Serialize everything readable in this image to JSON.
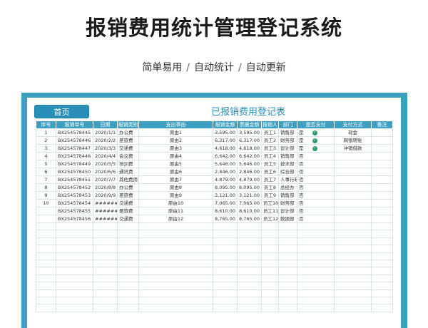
{
  "promo": {
    "title": "报销费用统计管理登记系统",
    "features": [
      "简单易用",
      "自动统计",
      "自动更新"
    ],
    "separator": "/"
  },
  "sheet": {
    "home_button": "首页",
    "title": "已报销费用登记表"
  },
  "table": {
    "headers": [
      "序号",
      "报销单号",
      "日期",
      "报销类别",
      "支出事由",
      "报销金额",
      "票据金额",
      "报销人",
      "部门",
      "是否支付",
      "支付方式",
      "备注"
    ],
    "rows": [
      {
        "no": "1",
        "id": "BX254578445",
        "date": "2020/1/1",
        "category": "办公费",
        "reason": "原由1",
        "amount": "3,595.00",
        "invoice": "3,595.00",
        "person": "员工1",
        "dept": "销售部",
        "paid": "是",
        "paid_icon": "check-icon",
        "method": "现金",
        "note": ""
      },
      {
        "no": "2",
        "id": "BX254578446",
        "date": "2020/2/2",
        "category": "差旅费",
        "reason": "原由2",
        "amount": "6,317.00",
        "invoice": "6,317.00",
        "person": "员工2",
        "dept": "财务部",
        "paid": "是",
        "paid_icon": "check-icon",
        "method": "网银转账",
        "note": ""
      },
      {
        "no": "3",
        "id": "BX254578447",
        "date": "2020/3/3",
        "category": "交通费",
        "reason": "原由3",
        "amount": "4,618.00",
        "invoice": "4,618.00",
        "person": "员工3",
        "dept": "设计部",
        "paid": "是",
        "paid_icon": "check-icon",
        "method": "冲销借款",
        "note": ""
      },
      {
        "no": "4",
        "id": "BX254578448",
        "date": "2020/4/4",
        "category": "会议费",
        "reason": "原由4",
        "amount": "6,642.00",
        "invoice": "6,642.00",
        "person": "员工4",
        "dept": "销售部",
        "paid": "否",
        "paid_icon": "",
        "method": "",
        "note": ""
      },
      {
        "no": "5",
        "id": "BX254578449",
        "date": "2020/5/5",
        "category": "培训费",
        "reason": "原由5",
        "amount": "5,646.00",
        "invoice": "5,646.00",
        "person": "员工5",
        "dept": "技术部",
        "paid": "否",
        "paid_icon": "",
        "method": "",
        "note": ""
      },
      {
        "no": "6",
        "id": "BX254578450",
        "date": "2020/6/6",
        "category": "通讯费",
        "reason": "原由6",
        "amount": "2,846.00",
        "invoice": "2,846.00",
        "person": "员工6",
        "dept": "综合部",
        "paid": "否",
        "paid_icon": "",
        "method": "",
        "note": ""
      },
      {
        "no": "7",
        "id": "BX254578451",
        "date": "2020/7/7",
        "category": "其他费用",
        "reason": "原由7",
        "amount": "4,879.00",
        "invoice": "4,879.00",
        "person": "员工7",
        "dept": "人事行政部",
        "paid": "否",
        "paid_icon": "",
        "method": "",
        "note": ""
      },
      {
        "no": "8",
        "id": "BX254578452",
        "date": "2020/8/8",
        "category": "办公费",
        "reason": "原由8",
        "amount": "8,095.00",
        "invoice": "8,095.00",
        "person": "员工8",
        "dept": "总经办",
        "paid": "否",
        "paid_icon": "",
        "method": "",
        "note": ""
      },
      {
        "no": "9",
        "id": "BX254578453",
        "date": "2020/9/9",
        "category": "差旅费",
        "reason": "原由9",
        "amount": "3,121.00",
        "invoice": "3,121.00",
        "person": "员工9",
        "dept": "销售部",
        "paid": "否",
        "paid_icon": "",
        "method": "",
        "note": ""
      },
      {
        "no": "10",
        "id": "BX254578454",
        "date": "#########",
        "category": "交通费",
        "reason": "原由10",
        "amount": "7,065.00",
        "invoice": "7,065.00",
        "person": "员工10",
        "dept": "财务部",
        "paid": "否",
        "paid_icon": "",
        "method": "",
        "note": ""
      },
      {
        "no": "",
        "id": "BX254578455",
        "date": "#########",
        "category": "差旅费",
        "reason": "原由11",
        "amount": "8,610.00",
        "invoice": "8,610.00",
        "person": "员工11",
        "dept": "设计部",
        "paid": "否",
        "paid_icon": "",
        "method": "",
        "note": ""
      },
      {
        "no": "",
        "id": "BX254578456",
        "date": "#########",
        "category": "交通费",
        "reason": "原由12",
        "amount": "8,765.00",
        "invoice": "8,765.00",
        "person": "员工12",
        "dept": "数据部",
        "paid": "否",
        "paid_icon": "",
        "method": "",
        "note": ""
      }
    ],
    "empty_rows": 12
  },
  "colors": {
    "accent": "#3ea0c0",
    "button": "#2a8fb6",
    "paid_check": "#2e9c6a"
  }
}
